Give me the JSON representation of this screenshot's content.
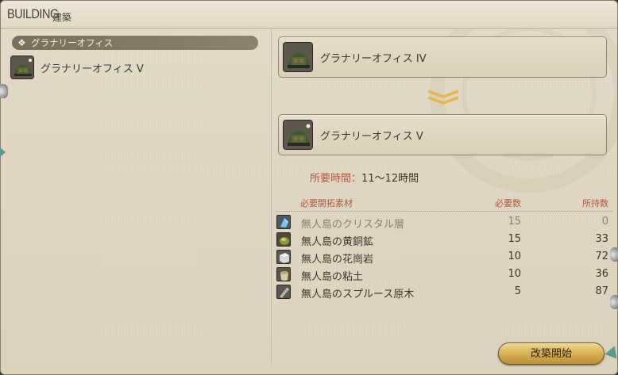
{
  "window": {
    "title_en": "BUILDING",
    "title_ja": "建築"
  },
  "list": {
    "category": {
      "bullet": "❖",
      "label": "グラナリーオフィス"
    },
    "items": [
      {
        "name": "グラナリーオフィス V",
        "icon": "granary-office-icon"
      }
    ]
  },
  "upgrade": {
    "current": {
      "name": "グラナリーオフィス IV",
      "icon": "granary-office-icon"
    },
    "next": {
      "name": "グラナリーオフィス V",
      "icon": "granary-office-icon"
    },
    "arrow_icon": "double-chevron-down-icon"
  },
  "time": {
    "label": "所要時間：",
    "value": "11〜12時間"
  },
  "materials": {
    "headers": {
      "name": "必要開拓素材",
      "required": "必要数",
      "owned": "所持数"
    },
    "rows": [
      {
        "name": "無人島のクリスタル層",
        "required": "15",
        "owned": "0",
        "icon": "crystal-layer-icon",
        "dim": true
      },
      {
        "name": "無人島の黄銅鉱",
        "required": "15",
        "owned": "33",
        "icon": "copper-ore-icon",
        "dim": false
      },
      {
        "name": "無人島の花崗岩",
        "required": "10",
        "owned": "72",
        "icon": "granite-icon",
        "dim": false
      },
      {
        "name": "無人島の粘土",
        "required": "10",
        "owned": "36",
        "icon": "clay-icon",
        "dim": false
      },
      {
        "name": "無人島のスプルース原木",
        "required": "5",
        "owned": "87",
        "icon": "spruce-log-icon",
        "dim": false
      }
    ]
  },
  "actions": {
    "start_label": "改築開始"
  },
  "colors": {
    "accent_label": "#b05a3c",
    "button_gold": "#d9b45a",
    "panel_bg": "#e0d7c4"
  }
}
